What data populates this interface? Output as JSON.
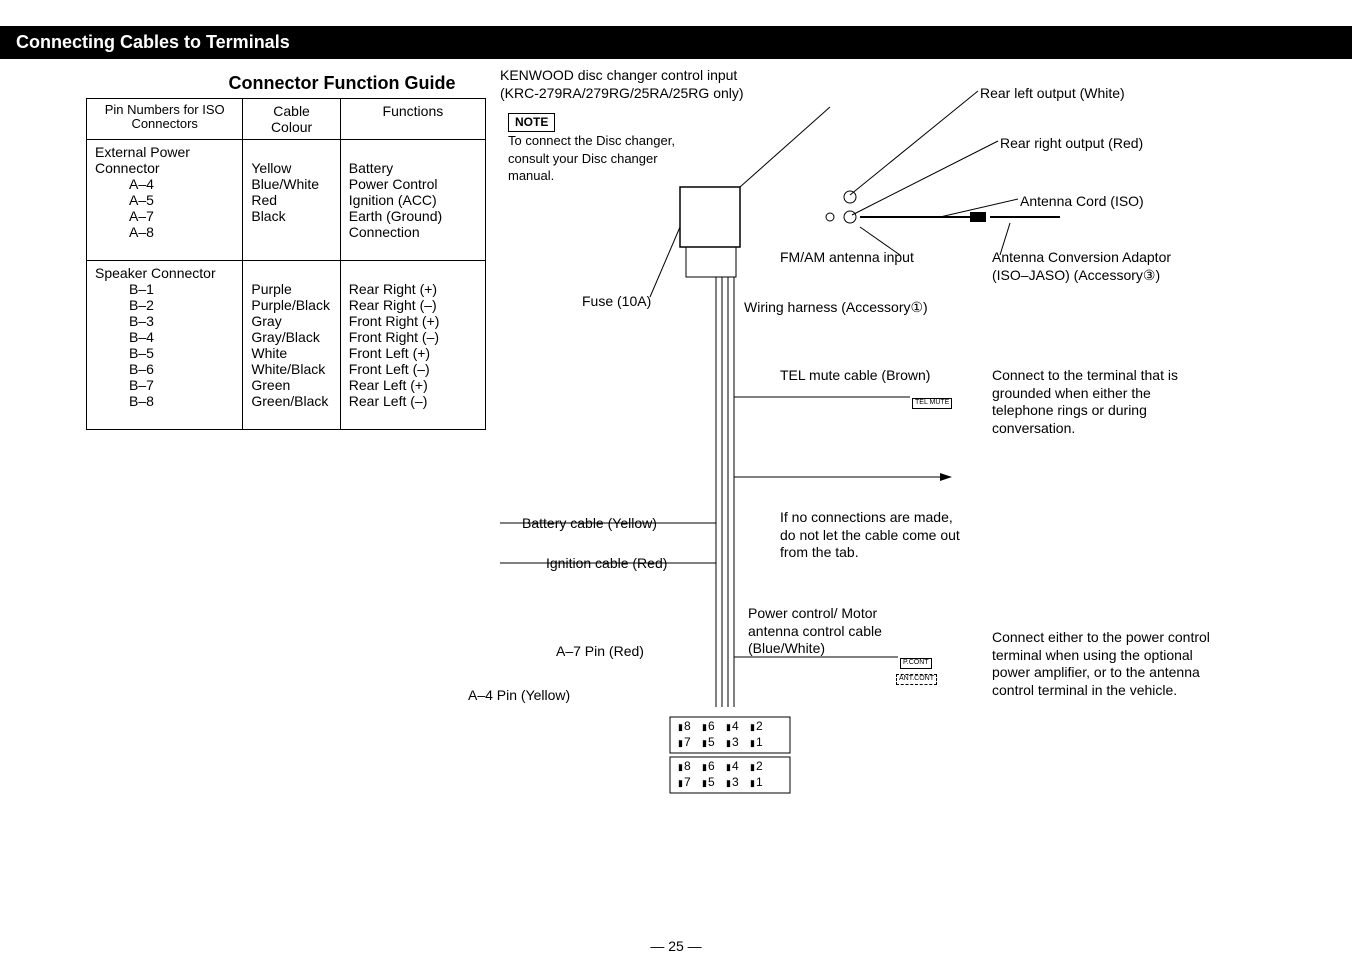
{
  "header": {
    "title": "Connecting Cables to Terminals"
  },
  "table": {
    "title": "Connector Function Guide",
    "columns": [
      "Pin Numbers for ISO Connectors",
      "Cable Colour",
      "Functions"
    ],
    "sections": [
      {
        "name": "External Power Connector",
        "rows": [
          {
            "pin": "A–4",
            "colour": "Yellow",
            "func": "Battery"
          },
          {
            "pin": "A–5",
            "colour": "Blue/White",
            "func": "Power Control"
          },
          {
            "pin": "A–7",
            "colour": "Red",
            "func": "Ignition (ACC)"
          },
          {
            "pin": "A–8",
            "colour": "Black",
            "func": "Earth (Ground) Connection"
          }
        ]
      },
      {
        "name": "Speaker Connector",
        "rows": [
          {
            "pin": "B–1",
            "colour": "Purple",
            "func": "Rear Right (+)"
          },
          {
            "pin": "B–2",
            "colour": "Purple/Black",
            "func": "Rear Right (–)"
          },
          {
            "pin": "B–3",
            "colour": "Gray",
            "func": "Front Right (+)"
          },
          {
            "pin": "B–4",
            "colour": "Gray/Black",
            "func": "Front Right (–)"
          },
          {
            "pin": "B–5",
            "colour": "White",
            "func": "Front Left (+)"
          },
          {
            "pin": "B–6",
            "colour": "White/Black",
            "func": "Front Left (–)"
          },
          {
            "pin": "B–7",
            "colour": "Green",
            "func": "Rear Left (+)"
          },
          {
            "pin": "B–8",
            "colour": "Green/Black",
            "func": "Rear Left (–)"
          }
        ]
      }
    ]
  },
  "diagram": {
    "disc_changer": "KENWOOD disc changer control input",
    "disc_changer_sub": "(KRC-279RA/279RG/25RA/25RG only)",
    "note_label": "NOTE",
    "note_text": "To connect the Disc changer, consult your Disc changer manual.",
    "rear_left": "Rear left output (White)",
    "rear_right": "Rear right output (Red)",
    "antenna_cord": "Antenna Cord (ISO)",
    "fm_am": "FM/AM antenna input",
    "antenna_adaptor": "Antenna Conversion Adaptor (ISO–JASO) (Accessory③)",
    "fuse": "Fuse (10A)",
    "wiring_harness": "Wiring harness (Accessory①)",
    "tel_mute": "TEL mute cable (Brown)",
    "tel_mute_tag": "TEL MUTE",
    "tel_mute_desc": "Connect to the terminal that is grounded when either the telephone rings or during conversation.",
    "battery_cable": "Battery cable (Yellow)",
    "ignition_cable": "Ignition cable (Red)",
    "no_connections": "If no connections are made, do not let the cable come out from the tab.",
    "power_control": "Power control/ Motor antenna control cable (Blue/White)",
    "pcont_tag": "P.CONT",
    "antcont_tag": "ANT.CONT",
    "power_control_desc": "Connect either to the power control terminal when using the optional power amplifier, or to the antenna control terminal in the vehicle.",
    "a7_pin": "A–7 Pin (Red)",
    "a4_pin": "A–4 Pin (Yellow)",
    "pin_upper_top": [
      "8",
      "6",
      "4",
      "2"
    ],
    "pin_upper_bottom": [
      "7",
      "5",
      "3",
      "1"
    ],
    "pin_lower_top": [
      "8",
      "6",
      "4",
      "2"
    ],
    "pin_lower_bottom": [
      "7",
      "5",
      "3",
      "1"
    ]
  },
  "page_number": "— 25 —"
}
